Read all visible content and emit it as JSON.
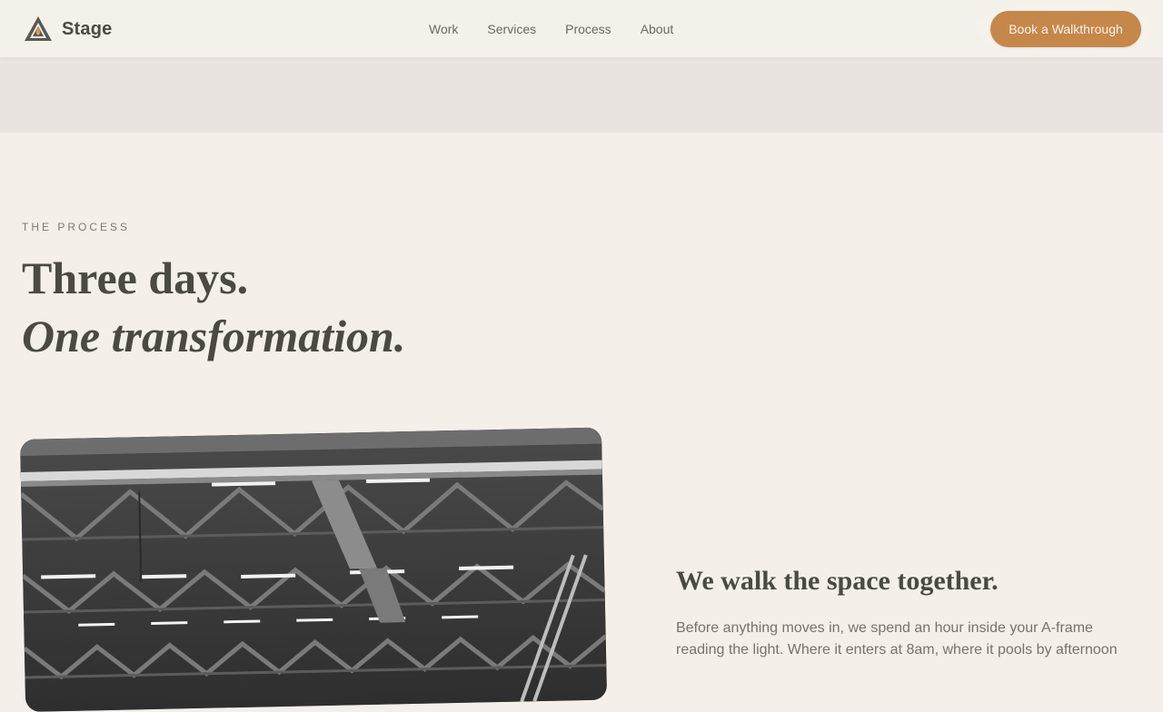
{
  "header": {
    "brand_name": "Stage",
    "logo_icon": "triangle-flame-logo",
    "nav": [
      {
        "label": "Work"
      },
      {
        "label": "Services"
      },
      {
        "label": "Process"
      },
      {
        "label": "About"
      }
    ],
    "cta_label": "Book a Walkthrough"
  },
  "process": {
    "eyebrow": "THE PROCESS",
    "heading_line1": "Three days.",
    "heading_line2": "One transformation.",
    "step": {
      "title": "We walk the space together.",
      "body": "Before anything moves in, we spend an hour inside your A-frame reading the light. Where it enters at 8am, where it pools by afternoon"
    }
  },
  "colors": {
    "background": "#f4efe9",
    "band": "#e9e4df",
    "accent": "#c6874a",
    "text": "#4a4a42",
    "muted_text": "#75746b"
  }
}
